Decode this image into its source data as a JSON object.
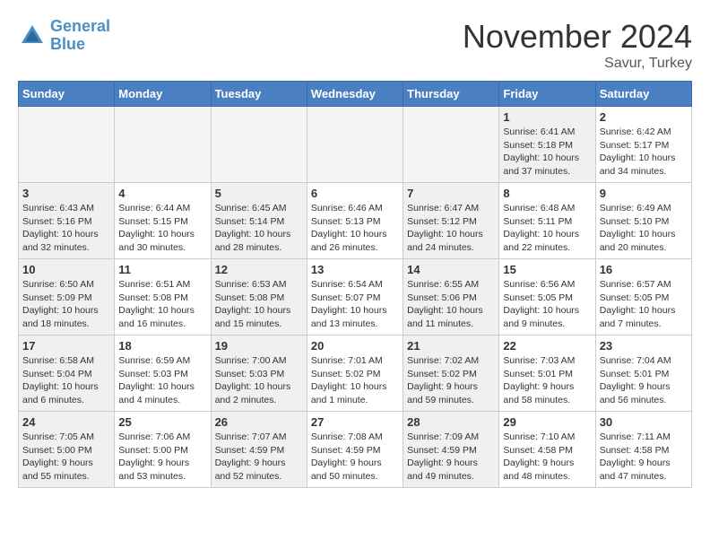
{
  "header": {
    "logo_line1": "General",
    "logo_line2": "Blue",
    "month": "November 2024",
    "location": "Savur, Turkey"
  },
  "weekdays": [
    "Sunday",
    "Monday",
    "Tuesday",
    "Wednesday",
    "Thursday",
    "Friday",
    "Saturday"
  ],
  "weeks": [
    [
      {
        "day": "",
        "info": "",
        "empty": true
      },
      {
        "day": "",
        "info": "",
        "empty": true
      },
      {
        "day": "",
        "info": "",
        "empty": true
      },
      {
        "day": "",
        "info": "",
        "empty": true
      },
      {
        "day": "",
        "info": "",
        "empty": true
      },
      {
        "day": "1",
        "info": "Sunrise: 6:41 AM\nSunset: 5:18 PM\nDaylight: 10 hours\nand 37 minutes.",
        "shaded": true
      },
      {
        "day": "2",
        "info": "Sunrise: 6:42 AM\nSunset: 5:17 PM\nDaylight: 10 hours\nand 34 minutes.",
        "shaded": false
      }
    ],
    [
      {
        "day": "3",
        "info": "Sunrise: 6:43 AM\nSunset: 5:16 PM\nDaylight: 10 hours\nand 32 minutes.",
        "shaded": true
      },
      {
        "day": "4",
        "info": "Sunrise: 6:44 AM\nSunset: 5:15 PM\nDaylight: 10 hours\nand 30 minutes.",
        "shaded": false
      },
      {
        "day": "5",
        "info": "Sunrise: 6:45 AM\nSunset: 5:14 PM\nDaylight: 10 hours\nand 28 minutes.",
        "shaded": true
      },
      {
        "day": "6",
        "info": "Sunrise: 6:46 AM\nSunset: 5:13 PM\nDaylight: 10 hours\nand 26 minutes.",
        "shaded": false
      },
      {
        "day": "7",
        "info": "Sunrise: 6:47 AM\nSunset: 5:12 PM\nDaylight: 10 hours\nand 24 minutes.",
        "shaded": true
      },
      {
        "day": "8",
        "info": "Sunrise: 6:48 AM\nSunset: 5:11 PM\nDaylight: 10 hours\nand 22 minutes.",
        "shaded": false
      },
      {
        "day": "9",
        "info": "Sunrise: 6:49 AM\nSunset: 5:10 PM\nDaylight: 10 hours\nand 20 minutes.",
        "shaded": false
      }
    ],
    [
      {
        "day": "10",
        "info": "Sunrise: 6:50 AM\nSunset: 5:09 PM\nDaylight: 10 hours\nand 18 minutes.",
        "shaded": true
      },
      {
        "day": "11",
        "info": "Sunrise: 6:51 AM\nSunset: 5:08 PM\nDaylight: 10 hours\nand 16 minutes.",
        "shaded": false
      },
      {
        "day": "12",
        "info": "Sunrise: 6:53 AM\nSunset: 5:08 PM\nDaylight: 10 hours\nand 15 minutes.",
        "shaded": true
      },
      {
        "day": "13",
        "info": "Sunrise: 6:54 AM\nSunset: 5:07 PM\nDaylight: 10 hours\nand 13 minutes.",
        "shaded": false
      },
      {
        "day": "14",
        "info": "Sunrise: 6:55 AM\nSunset: 5:06 PM\nDaylight: 10 hours\nand 11 minutes.",
        "shaded": true
      },
      {
        "day": "15",
        "info": "Sunrise: 6:56 AM\nSunset: 5:05 PM\nDaylight: 10 hours\nand 9 minutes.",
        "shaded": false
      },
      {
        "day": "16",
        "info": "Sunrise: 6:57 AM\nSunset: 5:05 PM\nDaylight: 10 hours\nand 7 minutes.",
        "shaded": false
      }
    ],
    [
      {
        "day": "17",
        "info": "Sunrise: 6:58 AM\nSunset: 5:04 PM\nDaylight: 10 hours\nand 6 minutes.",
        "shaded": true
      },
      {
        "day": "18",
        "info": "Sunrise: 6:59 AM\nSunset: 5:03 PM\nDaylight: 10 hours\nand 4 minutes.",
        "shaded": false
      },
      {
        "day": "19",
        "info": "Sunrise: 7:00 AM\nSunset: 5:03 PM\nDaylight: 10 hours\nand 2 minutes.",
        "shaded": true
      },
      {
        "day": "20",
        "info": "Sunrise: 7:01 AM\nSunset: 5:02 PM\nDaylight: 10 hours\nand 1 minute.",
        "shaded": false
      },
      {
        "day": "21",
        "info": "Sunrise: 7:02 AM\nSunset: 5:02 PM\nDaylight: 9 hours\nand 59 minutes.",
        "shaded": true
      },
      {
        "day": "22",
        "info": "Sunrise: 7:03 AM\nSunset: 5:01 PM\nDaylight: 9 hours\nand 58 minutes.",
        "shaded": false
      },
      {
        "day": "23",
        "info": "Sunrise: 7:04 AM\nSunset: 5:01 PM\nDaylight: 9 hours\nand 56 minutes.",
        "shaded": false
      }
    ],
    [
      {
        "day": "24",
        "info": "Sunrise: 7:05 AM\nSunset: 5:00 PM\nDaylight: 9 hours\nand 55 minutes.",
        "shaded": true
      },
      {
        "day": "25",
        "info": "Sunrise: 7:06 AM\nSunset: 5:00 PM\nDaylight: 9 hours\nand 53 minutes.",
        "shaded": false
      },
      {
        "day": "26",
        "info": "Sunrise: 7:07 AM\nSunset: 4:59 PM\nDaylight: 9 hours\nand 52 minutes.",
        "shaded": true
      },
      {
        "day": "27",
        "info": "Sunrise: 7:08 AM\nSunset: 4:59 PM\nDaylight: 9 hours\nand 50 minutes.",
        "shaded": false
      },
      {
        "day": "28",
        "info": "Sunrise: 7:09 AM\nSunset: 4:59 PM\nDaylight: 9 hours\nand 49 minutes.",
        "shaded": true
      },
      {
        "day": "29",
        "info": "Sunrise: 7:10 AM\nSunset: 4:58 PM\nDaylight: 9 hours\nand 48 minutes.",
        "shaded": false
      },
      {
        "day": "30",
        "info": "Sunrise: 7:11 AM\nSunset: 4:58 PM\nDaylight: 9 hours\nand 47 minutes.",
        "shaded": false
      }
    ]
  ]
}
